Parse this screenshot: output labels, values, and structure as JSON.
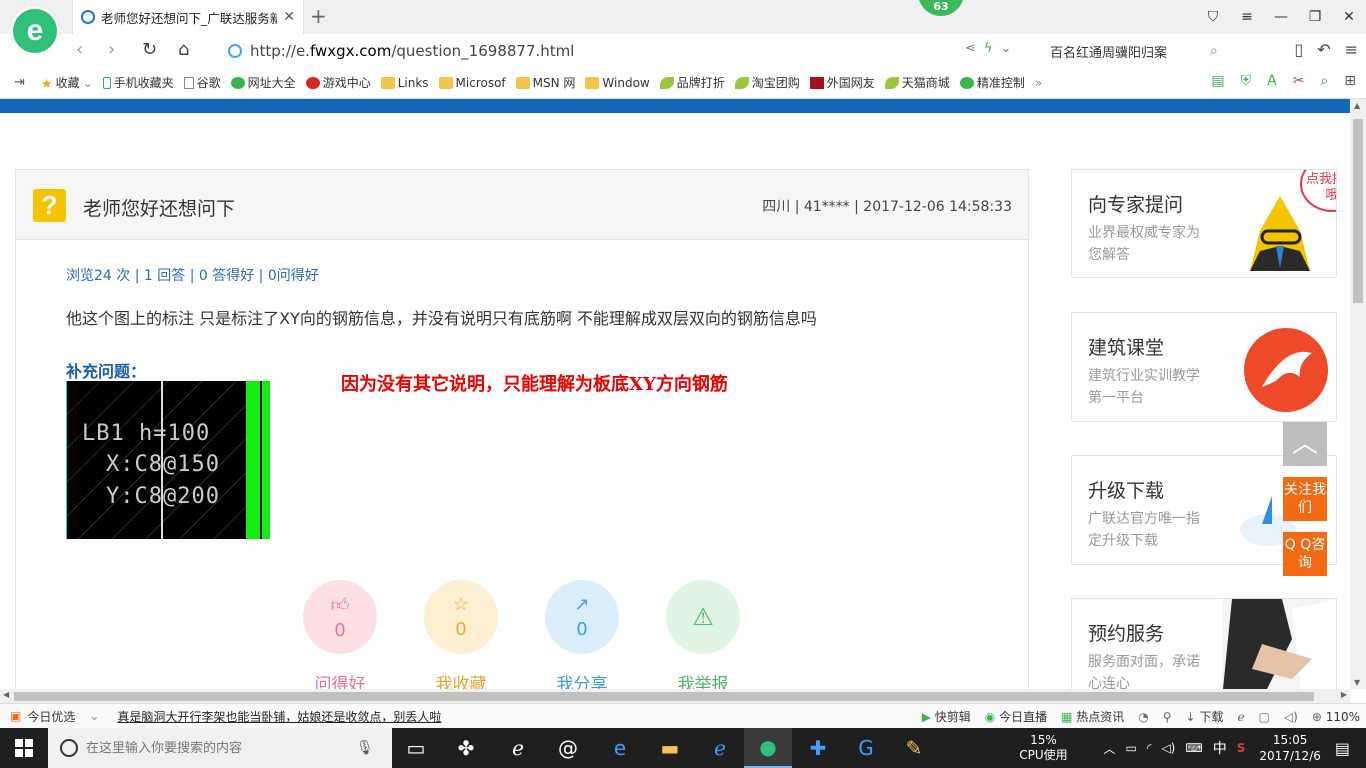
{
  "browser": {
    "tab": {
      "title": "老师您好还想问下_广联达服务新干线",
      "badge": "63"
    },
    "address": {
      "url_prefix": "http://e.",
      "url_domain": "fwxgx.com",
      "url_path": "/question_1698877.html"
    },
    "search": {
      "value": "百名红通周骥阳归案"
    },
    "bookmarks": [
      {
        "label": "收藏",
        "icon": "star-icon"
      },
      {
        "label": "手机收藏夹",
        "icon": "phone-icon"
      },
      {
        "label": "谷歌",
        "icon": "page-icon"
      },
      {
        "label": "网址大全",
        "icon": "green-circle-icon"
      },
      {
        "label": "游戏中心",
        "icon": "red-circle-icon"
      },
      {
        "label": "Links",
        "icon": "folder-icon"
      },
      {
        "label": "Microsof",
        "icon": "folder-icon"
      },
      {
        "label": "MSN 网",
        "icon": "folder-icon"
      },
      {
        "label": "Window",
        "icon": "folder-icon"
      },
      {
        "label": "品牌打折",
        "icon": "leaf-icon"
      },
      {
        "label": "淘宝团购",
        "icon": "leaf-icon"
      },
      {
        "label": "外国网友",
        "icon": "dark-red-icon"
      },
      {
        "label": "天猫商城",
        "icon": "leaf-icon"
      },
      {
        "label": "精准控制",
        "icon": "green-circle-icon"
      }
    ]
  },
  "question": {
    "title": "老师您好还想问下",
    "meta": "四川 | 41**** | 2017-12-06 14:58:33",
    "stats": "浏览24 次 | 1 回答 | 0 答得好 | 0问得好",
    "body": "他这个图上的标注 只是标注了XY向的钢筋信息，并没有说明只有底筋啊    不能理解成双层双向的钢筋信息吗",
    "supplement_label": "补充问题：",
    "cad_lines": [
      "LB1 h=100",
      "X:C8@150",
      "Y:C8@200"
    ],
    "answer_text": "因为没有其它说明，只能理解为板底XY方向钢筋",
    "actions": [
      {
        "label": "问得好",
        "count": "0",
        "icon": "thumbs-up-icon"
      },
      {
        "label": "我收藏",
        "count": "0",
        "icon": "star-icon"
      },
      {
        "label": "我分享",
        "count": "0",
        "icon": "share-icon"
      },
      {
        "label": "我举报",
        "count": "",
        "icon": "warning-icon"
      }
    ]
  },
  "sidebar": {
    "cards": [
      {
        "title": "向专家提问",
        "subtitle": "业界最权威专家为您解答",
        "bubble": "点我提问哦"
      },
      {
        "title": "建筑课堂",
        "subtitle": "建筑行业实训教学第一平台"
      },
      {
        "title": "升级下载",
        "subtitle": "广联达官方唯一指定升级下载"
      },
      {
        "title": "预约服务",
        "subtitle": "服务面对面，承诺心连心"
      }
    ],
    "float_follow": "关注我们",
    "float_qq": "Q Q咨询"
  },
  "statusbar": {
    "today": "今日优选",
    "news": "真是脑洞大开行李架也能当卧铺，姑娘还是收敛点，别丢人啦",
    "right_items": [
      "快剪辑",
      "今日直播",
      "热点资讯",
      "下载",
      "110%"
    ]
  },
  "taskbar": {
    "search_placeholder": "在这里输入你要搜索的内容",
    "cpu_percent": "15%",
    "cpu_label": "CPU使用",
    "ime": "中",
    "time": "15:05",
    "date": "2017/12/6"
  },
  "colors": {
    "accent_blue": "#1466b8",
    "answer_red": "#e00000",
    "float_orange": "#f46a12"
  }
}
